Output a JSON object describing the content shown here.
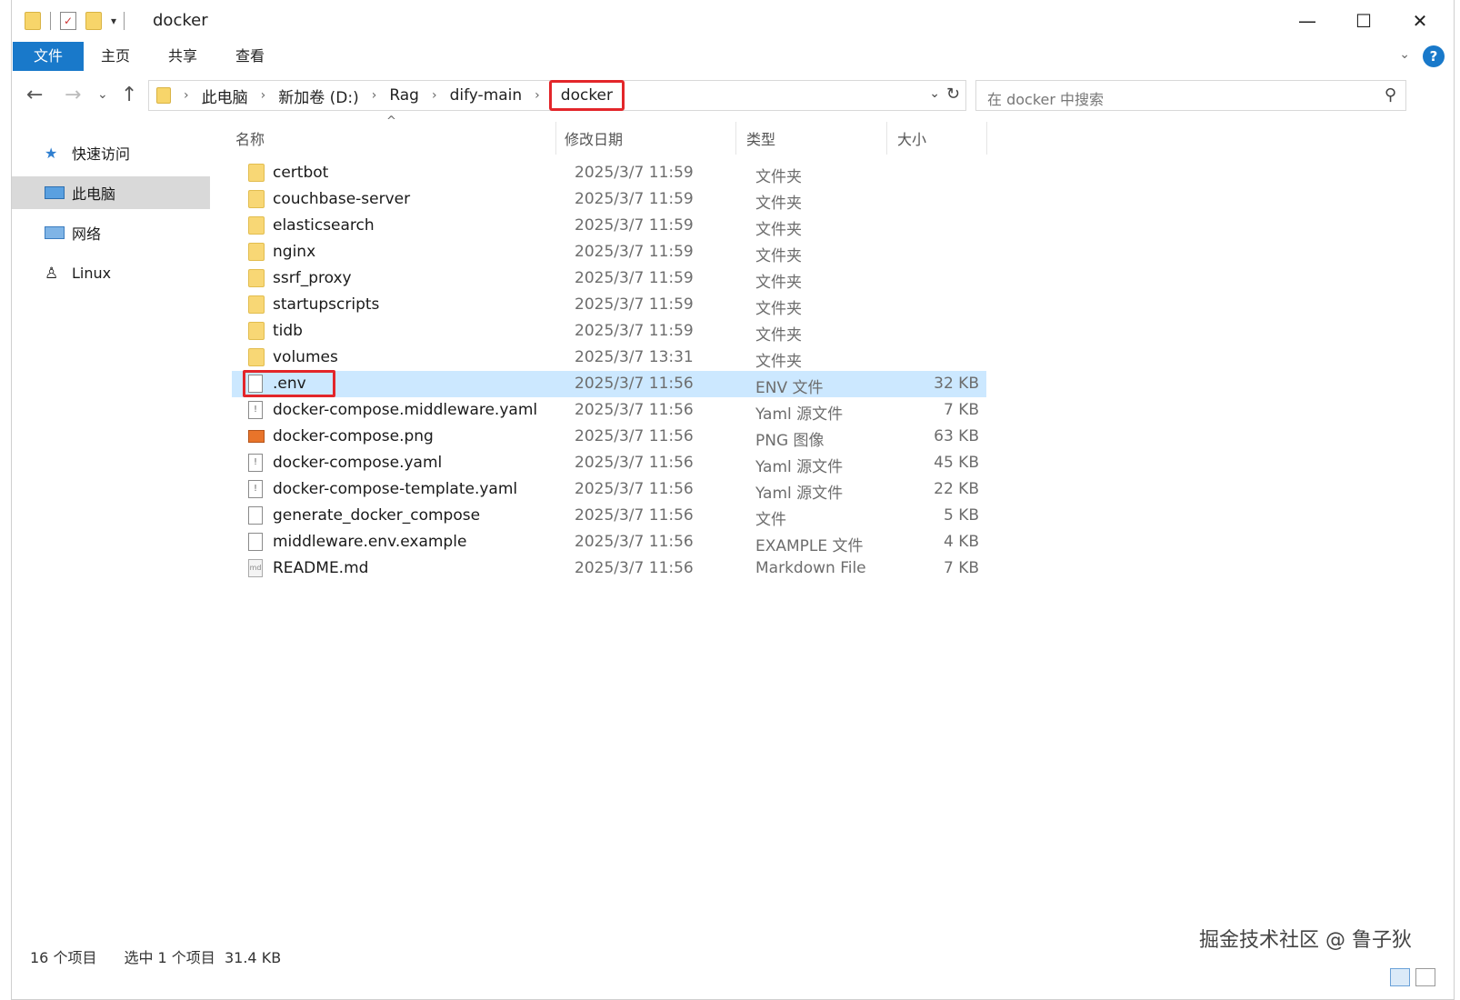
{
  "window": {
    "title": "docker",
    "controls": {
      "minimize": "—",
      "maximize": "☐",
      "close": "✕"
    }
  },
  "ribbon": {
    "tabs": [
      "文件",
      "主页",
      "共享",
      "查看"
    ],
    "help": "?"
  },
  "address": {
    "crumbs": [
      "此电脑",
      "新加卷 (D:)",
      "Rag",
      "dify-main"
    ],
    "current": "docker"
  },
  "search": {
    "placeholder": "在 docker 中搜索"
  },
  "sidebar": {
    "items": [
      "快速访问",
      "此电脑",
      "网络",
      "Linux"
    ],
    "active_index": 1
  },
  "columns": {
    "name": "名称",
    "date": "修改日期",
    "type": "类型",
    "size": "大小"
  },
  "files": [
    {
      "name": "certbot",
      "date": "2025/3/7 11:59",
      "type": "文件夹",
      "size": "",
      "icon": "folder-icon"
    },
    {
      "name": "couchbase-server",
      "date": "2025/3/7 11:59",
      "type": "文件夹",
      "size": "",
      "icon": "folder-icon"
    },
    {
      "name": "elasticsearch",
      "date": "2025/3/7 11:59",
      "type": "文件夹",
      "size": "",
      "icon": "folder-icon"
    },
    {
      "name": "nginx",
      "date": "2025/3/7 11:59",
      "type": "文件夹",
      "size": "",
      "icon": "folder-icon"
    },
    {
      "name": "ssrf_proxy",
      "date": "2025/3/7 11:59",
      "type": "文件夹",
      "size": "",
      "icon": "folder-icon"
    },
    {
      "name": "startupscripts",
      "date": "2025/3/7 11:59",
      "type": "文件夹",
      "size": "",
      "icon": "folder-icon"
    },
    {
      "name": "tidb",
      "date": "2025/3/7 11:59",
      "type": "文件夹",
      "size": "",
      "icon": "folder-icon"
    },
    {
      "name": "volumes",
      "date": "2025/3/7 13:31",
      "type": "文件夹",
      "size": "",
      "icon": "folder-icon"
    },
    {
      "name": ".env",
      "date": "2025/3/7 11:56",
      "type": "ENV 文件",
      "size": "32 KB",
      "icon": "file-icon"
    },
    {
      "name": "docker-compose.middleware.yaml",
      "date": "2025/3/7 11:56",
      "type": "Yaml 源文件",
      "size": "7 KB",
      "icon": "yaml-icon"
    },
    {
      "name": "docker-compose.png",
      "date": "2025/3/7 11:56",
      "type": "PNG 图像",
      "size": "63 KB",
      "icon": "image-icon"
    },
    {
      "name": "docker-compose.yaml",
      "date": "2025/3/7 11:56",
      "type": "Yaml 源文件",
      "size": "45 KB",
      "icon": "yaml-icon"
    },
    {
      "name": "docker-compose-template.yaml",
      "date": "2025/3/7 11:56",
      "type": "Yaml 源文件",
      "size": "22 KB",
      "icon": "yaml-icon"
    },
    {
      "name": "generate_docker_compose",
      "date": "2025/3/7 11:56",
      "type": "文件",
      "size": "5 KB",
      "icon": "file-icon"
    },
    {
      "name": "middleware.env.example",
      "date": "2025/3/7 11:56",
      "type": "EXAMPLE 文件",
      "size": "4 KB",
      "icon": "file-icon"
    },
    {
      "name": "README.md",
      "date": "2025/3/7 11:56",
      "type": "Markdown File",
      "size": "7 KB",
      "icon": "markdown-icon"
    }
  ],
  "selected_index": 8,
  "status": {
    "count": "16 个项目",
    "selection": "选中 1 个项目",
    "selection_size": "31.4 KB"
  },
  "watermark": "掘金技术社区 @ 鲁子狄",
  "colors": {
    "accent": "#1979ca",
    "selection": "#cce8ff",
    "highlight_border": "#e3262a",
    "folder": "#f8d775"
  }
}
